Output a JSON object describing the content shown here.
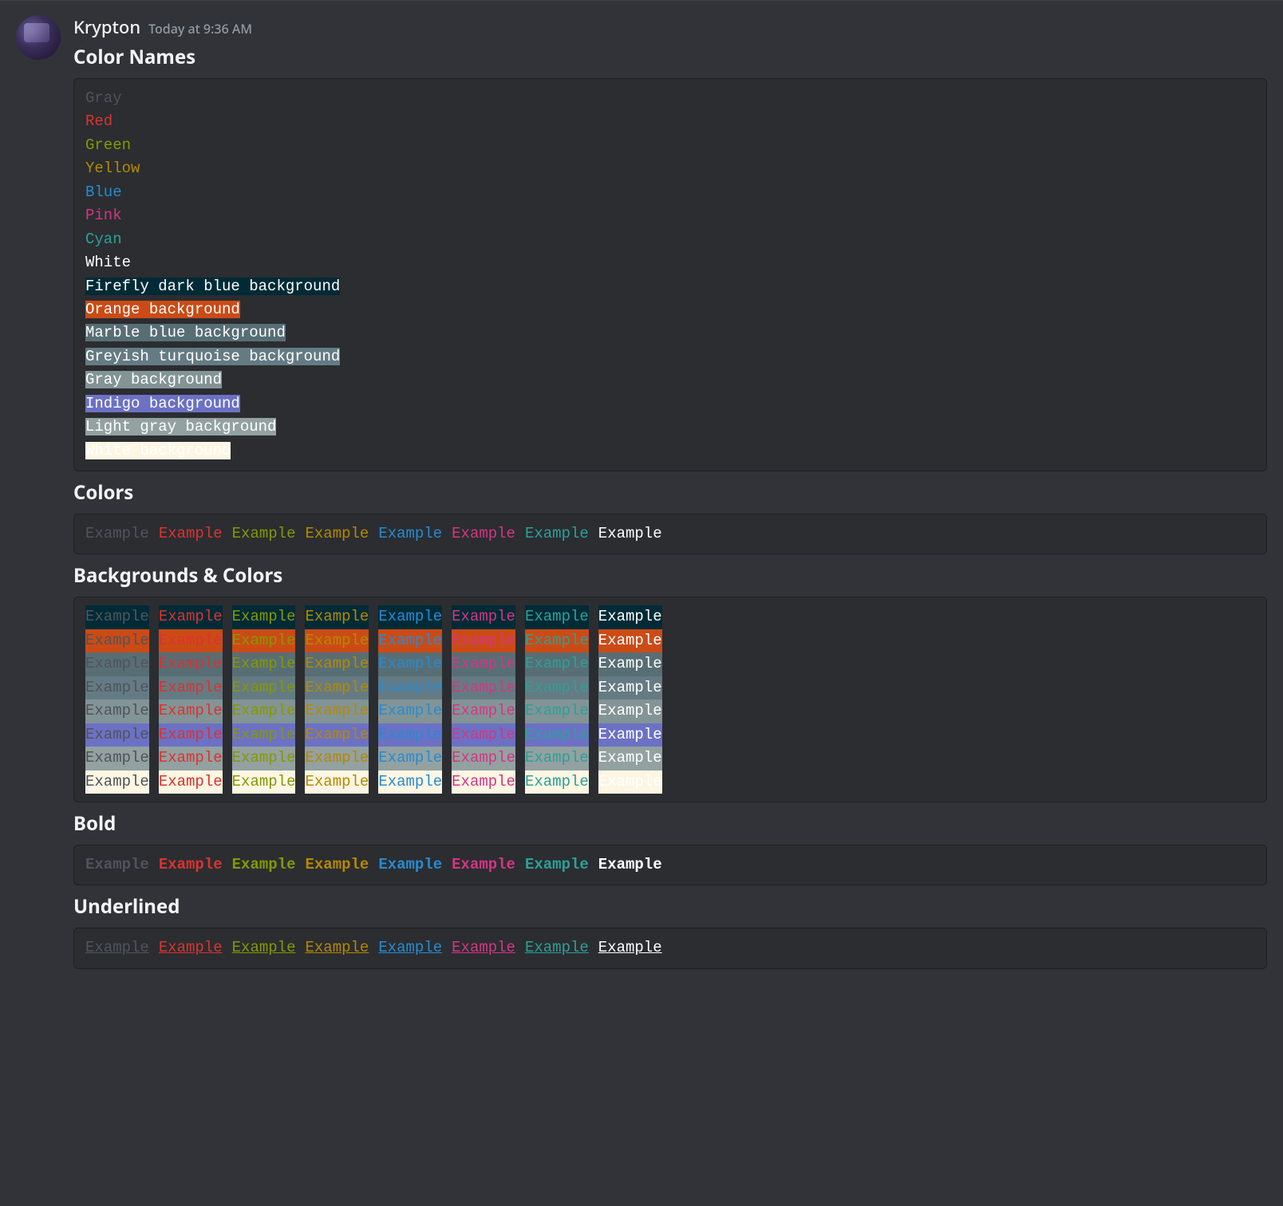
{
  "message": {
    "username": "Krypton",
    "timestamp": "Today at 9:36 AM"
  },
  "sections": {
    "color_names": "Color Names",
    "colors": "Colors",
    "bg_colors": "Backgrounds & Colors",
    "bold": "Bold",
    "underlined": "Underlined"
  },
  "example_word": "Example",
  "palette": {
    "fg": {
      "gray": "#4f545c",
      "red": "#dc322f",
      "green": "#859900",
      "yellow": "#b58900",
      "blue": "#268bd2",
      "pink": "#d33682",
      "cyan": "#2aa198",
      "white": "#ffffff"
    },
    "bg": {
      "firefly": "#002b36",
      "orange": "#cb4b16",
      "marble": "#586e75",
      "greyturq": "#657b83",
      "graybg": "#839496",
      "indigo": "#6c71c4",
      "lightgray": "#93a1a1",
      "whitebg": "#fdf6e3"
    }
  },
  "color_name_lines": [
    {
      "text": "Gray",
      "fg": "gray"
    },
    {
      "text": "Red",
      "fg": "red"
    },
    {
      "text": "Green",
      "fg": "green"
    },
    {
      "text": "Yellow",
      "fg": "yellow"
    },
    {
      "text": "Blue",
      "fg": "blue"
    },
    {
      "text": "Pink",
      "fg": "pink"
    },
    {
      "text": "Cyan",
      "fg": "cyan"
    },
    {
      "text": "White",
      "fg": "white"
    },
    {
      "text": "Firefly dark blue background",
      "fg": "white",
      "bg": "firefly"
    },
    {
      "text": "Orange background",
      "fg": "white",
      "bg": "orange"
    },
    {
      "text": "Marble blue background",
      "fg": "white",
      "bg": "marble"
    },
    {
      "text": "Greyish turquoise background",
      "fg": "white",
      "bg": "greyturq"
    },
    {
      "text": "Gray background",
      "fg": "white",
      "bg": "graybg"
    },
    {
      "text": "Indigo background",
      "fg": "white",
      "bg": "indigo"
    },
    {
      "text": "Light gray background",
      "fg": "white",
      "bg": "lightgray"
    },
    {
      "text": "White background",
      "fg": "white",
      "bg": "whitebg"
    }
  ],
  "fg_order": [
    "gray",
    "red",
    "green",
    "yellow",
    "blue",
    "pink",
    "cyan",
    "white"
  ],
  "bg_order": [
    "firefly",
    "orange",
    "marble",
    "greyturq",
    "graybg",
    "indigo",
    "lightgray",
    "whitebg"
  ]
}
